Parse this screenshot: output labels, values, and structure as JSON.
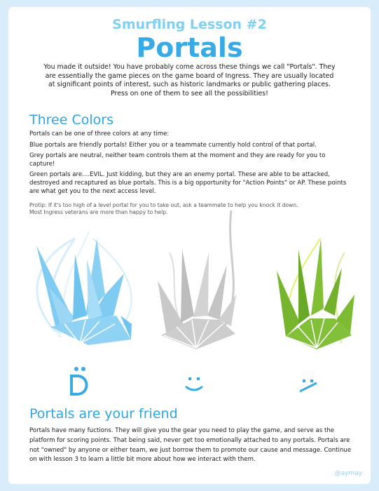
{
  "header": {
    "subtitle": "Smurfling Lesson #2",
    "title": "Portals"
  },
  "intro": "You made it outside! You have probably come across these things we call \"Portals\". They are essentially the game pieces on the game board of Ingress. They are usually located at significant points of interest, such as historic landmarks or public gathering places. Press on one of them to see all the possibilities!",
  "three_colors": {
    "heading": "Three Colors",
    "paragraphs": [
      "Portals can be one of three colors at any time:",
      "Blue portals are friendly portals! Either you or a teammate currently hold control of that portal.",
      "Grey portals are neutral, neither team controls them at the moment and they are ready for you to capture!",
      "Green portals are....EVIL. Just kidding, but they are an enemy portal. These are able to be attacked, destroyed and recaptured as blue portals. This is a big opportunity for \"Action Points\" or AP. These points are what get you to the next access level."
    ],
    "protip_line1": "Protip: If it's too high of a level portal for you to take out, ask a teammate to help you knock it down.",
    "protip_line2": "Most Ingress veterans are more than happy to help."
  },
  "portals": [
    {
      "name": "blue",
      "color": "#7fcbf2",
      "face": ":D"
    },
    {
      "name": "grey",
      "color": "#c9c9c9",
      "face": ":)"
    },
    {
      "name": "green",
      "color": "#77b52e",
      "face": ":/"
    }
  ],
  "friend": {
    "heading": "Portals are your friend",
    "text": "Portals have many fuctions. They will give you the gear you need to play the game, and serve as the platform for scoring points. That being said, never get too emotionally attached to any portals. Portals are not \"owned\" by anyone or either team, we just borrow them to promote our cause and message. Continue on with lesson 3 to learn a little bit more about how we interact with them."
  },
  "credit": "@aymay"
}
